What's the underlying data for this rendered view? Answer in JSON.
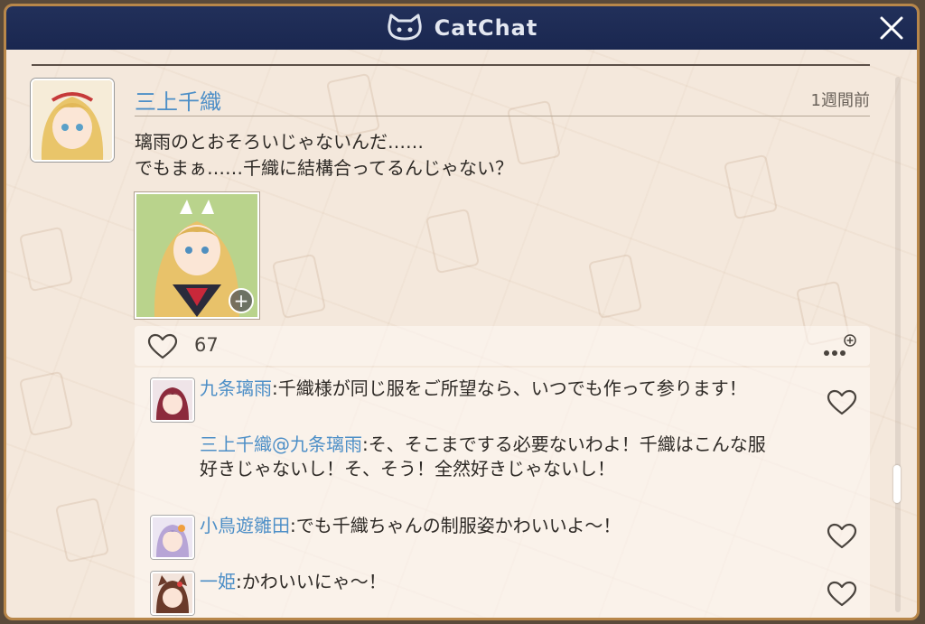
{
  "window": {
    "title": "CatChat",
    "icons": {
      "logo": "cat-face-icon",
      "close": "close-icon"
    }
  },
  "post": {
    "author": "三上千織",
    "timestamp": "1週間前",
    "text": "璃雨のとおそろいじゃないんだ……\nでもまぁ……千織に結構合ってるんじゃない？",
    "image_icon": "zoom-plus-icon",
    "likes": "67",
    "icons": {
      "like": "heart-outline-icon",
      "more": "more-options-icon"
    }
  },
  "comments": [
    {
      "name": "九条璃雨",
      "sep": ":",
      "text": "千織様が同じ服をご所望なら、いつでも作って参ります！",
      "avatar": "avatar-kujo-riu"
    },
    {
      "name": "三上千織@九条璃雨",
      "sep": ":",
      "text": "そ、そこまでする必要ないわよ！千織はこんな服好きじゃないし！そ、そう！全然好きじゃないし！"
    },
    {
      "name": "小鳥遊雛田",
      "sep": ":",
      "text": "でも千織ちゃんの制服姿かわいいよ～！",
      "avatar": "avatar-takanashi-hinata"
    },
    {
      "name": "一姫",
      "sep": ":",
      "text": "かわいいにゃ～！",
      "avatar": "avatar-ichihime"
    }
  ],
  "colors": {
    "titlebar": "#1a2750",
    "panel": "#f4e8dc",
    "frame": "#b8874a",
    "name_link": "#4d8fc7",
    "text": "#2e2a26"
  }
}
